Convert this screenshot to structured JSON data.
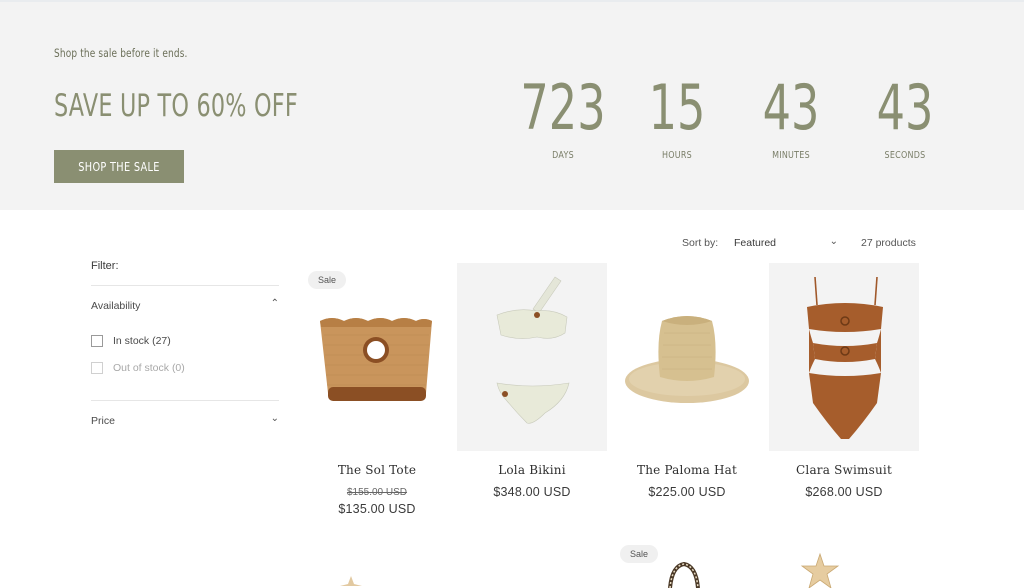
{
  "hero": {
    "tagline": "Shop the sale before it ends.",
    "title": "SAVE UP TO 60% OFF",
    "button_label": "SHOP THE SALE",
    "accent_color": "#8a8f72",
    "countdown": [
      {
        "value": "723",
        "label": "DAYS"
      },
      {
        "value": "15",
        "label": "HOURS"
      },
      {
        "value": "43",
        "label": "MINUTES"
      },
      {
        "value": "43",
        "label": "SECONDS"
      }
    ]
  },
  "filter": {
    "title": "Filter:",
    "availability": {
      "label": "Availability",
      "options": [
        {
          "label": "In stock (27)",
          "checked": false,
          "disabled": false
        },
        {
          "label": "Out of stock (0)",
          "checked": false,
          "disabled": true
        }
      ]
    },
    "price": {
      "label": "Price"
    }
  },
  "sort": {
    "label": "Sort by:",
    "selected": "Featured",
    "product_count": "27 products"
  },
  "products": [
    {
      "title": "The Sol Tote",
      "badge": "Sale",
      "compare_price": "$155.00 USD",
      "price": "$135.00 USD"
    },
    {
      "title": "Lola Bikini",
      "price": "$348.00 USD"
    },
    {
      "title": "The Paloma Hat",
      "price": "$225.00 USD"
    },
    {
      "title": "Clara Swimsuit",
      "price": "$268.00 USD"
    }
  ],
  "row2": {
    "badge": "Sale"
  }
}
